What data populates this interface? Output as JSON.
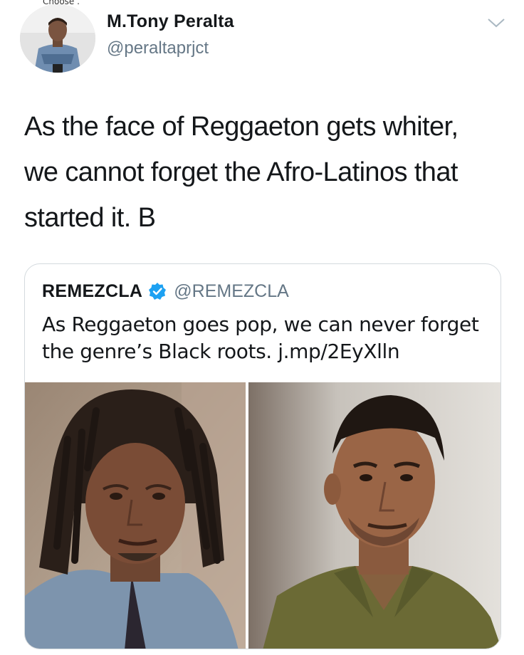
{
  "header": {
    "avatar_caption": "Choose .",
    "display_name": "M.Tony Peralta",
    "handle": "@peraltaprjct"
  },
  "tweet": {
    "line1": "As the face of Reggaeton gets whiter,",
    "line2": "we cannot forget the Afro-Latinos that",
    "line3": "started it. B"
  },
  "quoted_tweet": {
    "name": "REMEZCLA",
    "handle": "@REMEZCLA",
    "line1": "As Reggaeton goes pop, we can never forget",
    "line2": "the genre’s Black roots. j.mp/2EyXlln",
    "images": [
      "photo-left",
      "photo-right"
    ]
  },
  "colors": {
    "text": "#14171a",
    "secondary": "#657786",
    "verified": "#1da1f2",
    "border": "#d4dade"
  },
  "icons": {
    "verified": "verified-badge-icon",
    "menu": "chevron-down-icon"
  }
}
